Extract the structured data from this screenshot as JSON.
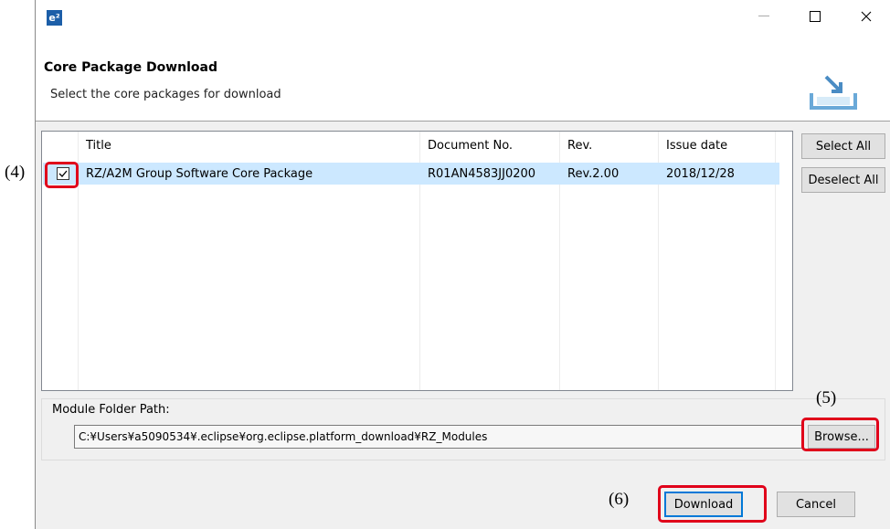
{
  "window": {
    "app_icon_label": "e²",
    "controls": {
      "minimize": "—",
      "maximize": "☐",
      "close": "✕"
    }
  },
  "header": {
    "title": "Core Package Download",
    "subtitle": "Select the core packages for download"
  },
  "table": {
    "columns": [
      "Title",
      "Document No.",
      "Rev.",
      "Issue date"
    ],
    "rows": [
      {
        "checked": true,
        "title": "RZ/A2M Group Software Core Package",
        "document_no": "R01AN4583JJ0200",
        "rev": "Rev.2.00",
        "issue_date": "2018/12/28"
      }
    ]
  },
  "side_buttons": {
    "select_all": "Select All",
    "deselect_all": "Deselect All"
  },
  "module_folder": {
    "label": "Module Folder Path:",
    "path": "C:¥Users¥a5090534¥.eclipse¥org.eclipse.platform_download¥RZ_Modules",
    "browse": "Browse..."
  },
  "footer": {
    "download": "Download",
    "cancel": "Cancel"
  },
  "annotations": {
    "a4": "(4)",
    "a5": "(5)",
    "a6": "(6)"
  },
  "colors": {
    "highlight": "#e0001a",
    "selected_row": "#cce8ff",
    "default_button_border": "#0078d7"
  }
}
